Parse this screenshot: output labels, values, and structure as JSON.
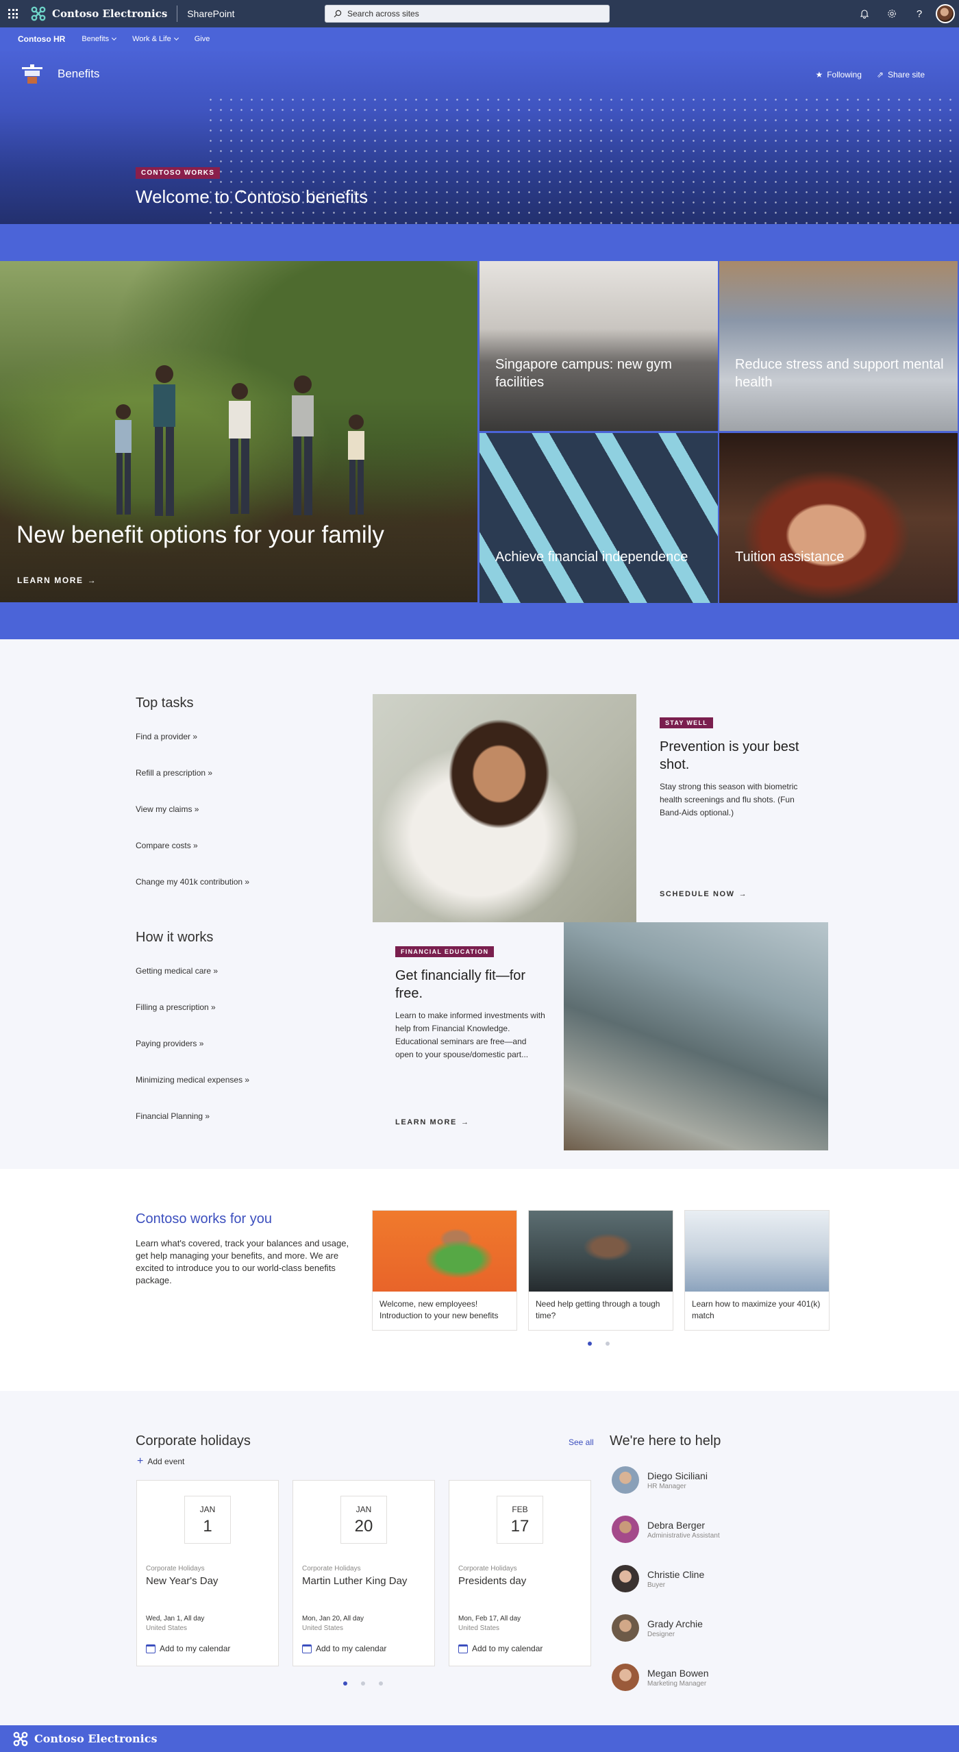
{
  "suite_bar": {
    "brand": "Contoso Electronics",
    "app": "SharePoint",
    "search_placeholder": "Search across sites"
  },
  "hub_nav": {
    "title": "Contoso HR",
    "items": [
      {
        "label": "Benefits",
        "has_menu": true
      },
      {
        "label": "Work & Life",
        "has_menu": true
      },
      {
        "label": "Give",
        "has_menu": false
      }
    ]
  },
  "site_header": {
    "name": "Benefits",
    "following": "Following",
    "share": "Share site"
  },
  "hero": {
    "tag": "CONTOSO WORKS",
    "title": "Welcome to Contoso benefits"
  },
  "hero_tiles": {
    "main": {
      "title": "New benefit options for your family",
      "cta": "LEARN MORE"
    },
    "tiles": [
      {
        "title": "Singapore campus: new gym facilities"
      },
      {
        "title": "Reduce stress and support mental health"
      },
      {
        "title": "Achieve financial independence"
      },
      {
        "title": "Tuition assistance"
      }
    ]
  },
  "top_tasks": {
    "title": "Top tasks",
    "links": [
      "Find a provider »",
      "Refill a prescription »",
      "View my claims »",
      "Compare costs »",
      "Change my 401k contribution »"
    ]
  },
  "how_it_works": {
    "title": "How it works",
    "links": [
      "Getting medical care »",
      "Filling a prescription »",
      "Paying providers »",
      "Minimizing medical expenses »",
      "Financial Planning »"
    ]
  },
  "stay_well": {
    "tag": "STAY WELL",
    "title": "Prevention is your best shot.",
    "desc": "Stay strong this season with biometric health screenings and flu shots. (Fun Band-Aids optional.)",
    "cta": "SCHEDULE NOW"
  },
  "financial": {
    "tag": "FINANCIAL EDUCATION",
    "title": "Get financially fit—for free.",
    "desc": "Learn to make informed investments with help from Financial Knowledge. Educational seminars are free—and open to your spouse/domestic part...",
    "cta": "LEARN MORE"
  },
  "works_for_you": {
    "title": "Contoso works for you",
    "desc": "Learn what's covered, track your balances and usage, get help managing your benefits, and more. We are excited to introduce you to our world-class benefits package.",
    "cards": [
      {
        "text": "Welcome, new employees! Introduction to your new benefits"
      },
      {
        "text": "Need help getting through a tough time?"
      },
      {
        "text": "Learn how to maximize your 401(k) match"
      }
    ]
  },
  "holidays": {
    "title": "Corporate holidays",
    "see_all": "See all",
    "add_event": "Add event",
    "events": [
      {
        "month": "JAN",
        "day": "1",
        "category": "Corporate Holidays",
        "name": "New Year's Day",
        "when": "Wed, Jan 1, All day",
        "location": "United States",
        "add": "Add to my calendar"
      },
      {
        "month": "JAN",
        "day": "20",
        "category": "Corporate Holidays",
        "name": "Martin Luther King Day",
        "when": "Mon, Jan 20, All day",
        "location": "United States",
        "add": "Add to my calendar"
      },
      {
        "month": "FEB",
        "day": "17",
        "category": "Corporate Holidays",
        "name": "Presidents day",
        "when": "Mon, Feb 17, All day",
        "location": "United States",
        "add": "Add to my calendar"
      }
    ]
  },
  "help": {
    "title": "We're here to help",
    "people": [
      {
        "name": "Diego Siciliani",
        "role": "HR Manager",
        "color": "#8aa0b8"
      },
      {
        "name": "Debra Berger",
        "role": "Administrative Assistant",
        "color": "#a44a8a"
      },
      {
        "name": "Christie Cline",
        "role": "Buyer",
        "color": "#3a3230"
      },
      {
        "name": "Grady Archie",
        "role": "Designer",
        "color": "#6d5a48"
      },
      {
        "name": "Megan Bowen",
        "role": "Marketing Manager",
        "color": "#9a5a3a"
      }
    ]
  },
  "footer": {
    "brand": "Contoso Electronics"
  },
  "colors": {
    "accent": "#4b64d8",
    "suite_bar": "#2c3a55",
    "tag": "#7a1f4e",
    "link": "#3c4fbe"
  }
}
